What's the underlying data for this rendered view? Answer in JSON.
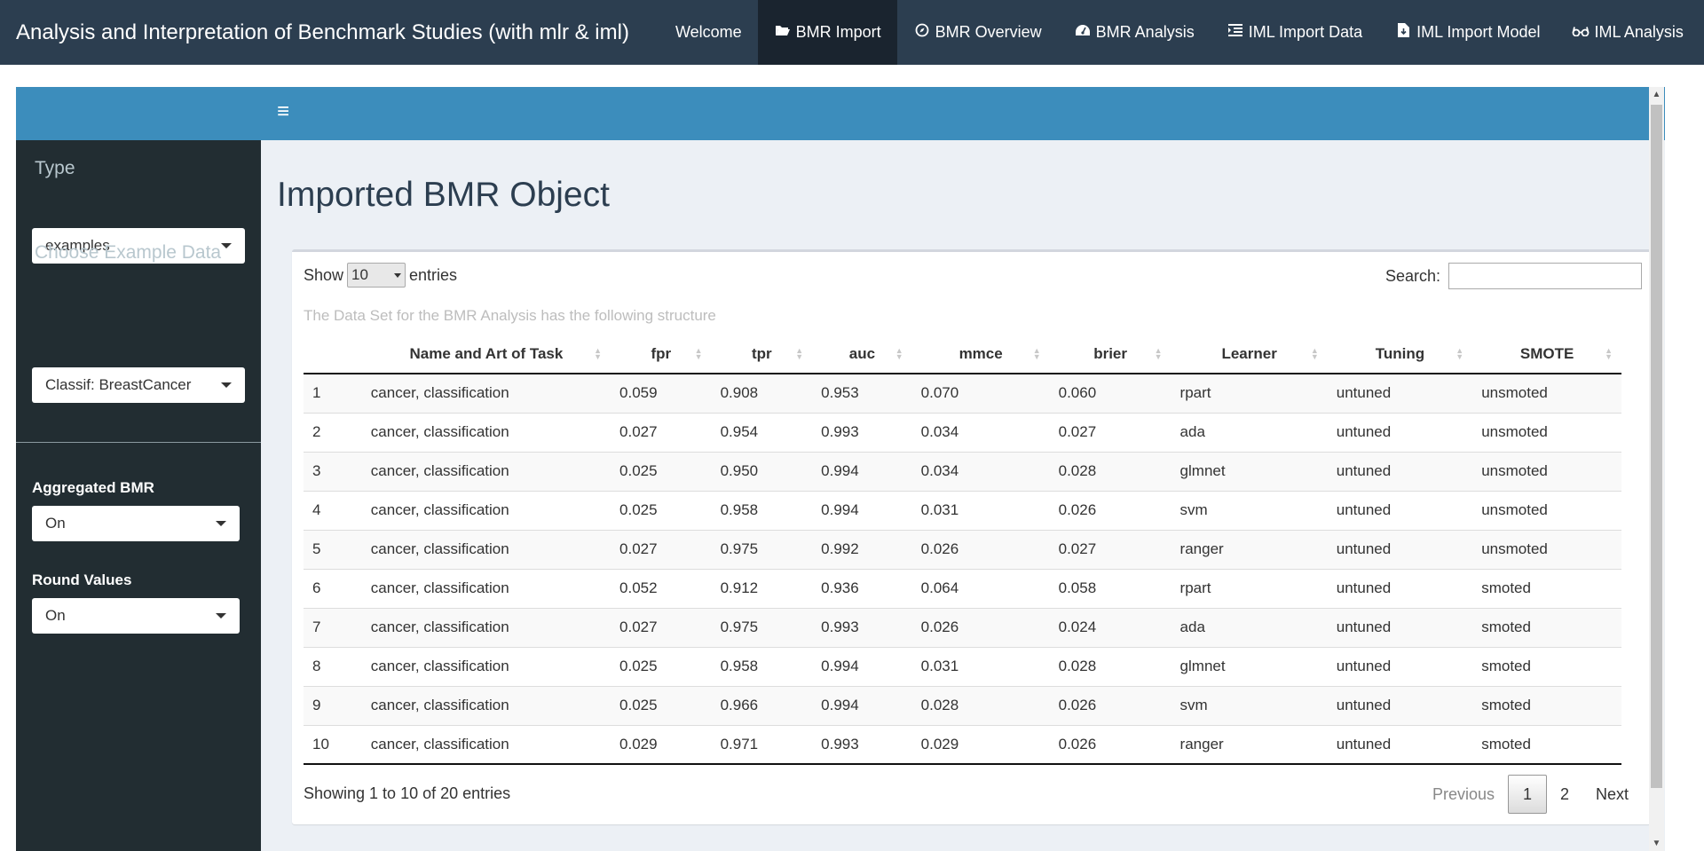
{
  "app": {
    "title": "Analysis and Interpretation of Benchmark Studies (with mlr & iml)"
  },
  "nav": [
    {
      "label": "Welcome",
      "icon": "",
      "active": false
    },
    {
      "label": "BMR Import",
      "icon": "folder-open-icon",
      "active": true
    },
    {
      "label": "BMR Overview",
      "icon": "compass-icon",
      "active": false
    },
    {
      "label": "BMR Analysis",
      "icon": "dashboard-icon",
      "active": false
    },
    {
      "label": "IML Import Data",
      "icon": "indent-icon",
      "active": false
    },
    {
      "label": "IML Import Model",
      "icon": "file-import-icon",
      "active": false
    },
    {
      "label": "IML Analysis",
      "icon": "glasses-icon",
      "active": false
    }
  ],
  "sidebar": {
    "type_label": "Type",
    "type_value": "examples",
    "example_label": "Choose Example Data",
    "example_value": "Classif: BreastCancer",
    "aggregated_label": "Aggregated BMR",
    "aggregated_value": "On",
    "round_label": "Round Values",
    "round_value": "On"
  },
  "main": {
    "title": "Imported BMR Object",
    "show_label": "Show",
    "length_value": "10",
    "entries_label": "entries",
    "search_label": "Search:",
    "search_value": "",
    "caption": "The Data Set for the BMR Analysis has the following structure",
    "info": "Showing 1 to 10 of 20 entries",
    "pager": {
      "previous": "Previous",
      "pages": [
        "1",
        "2"
      ],
      "current": "1",
      "next": "Next"
    }
  },
  "table": {
    "columns": [
      "",
      "Name and Art of Task",
      "fpr",
      "tpr",
      "auc",
      "mmce",
      "brier",
      "Learner",
      "Tuning",
      "SMOTE"
    ],
    "rows": [
      [
        "1",
        "cancer, classification",
        "0.059",
        "0.908",
        "0.953",
        "0.070",
        "0.060",
        "rpart",
        "untuned",
        "unsmoted"
      ],
      [
        "2",
        "cancer, classification",
        "0.027",
        "0.954",
        "0.993",
        "0.034",
        "0.027",
        "ada",
        "untuned",
        "unsmoted"
      ],
      [
        "3",
        "cancer, classification",
        "0.025",
        "0.950",
        "0.994",
        "0.034",
        "0.028",
        "glmnet",
        "untuned",
        "unsmoted"
      ],
      [
        "4",
        "cancer, classification",
        "0.025",
        "0.958",
        "0.994",
        "0.031",
        "0.026",
        "svm",
        "untuned",
        "unsmoted"
      ],
      [
        "5",
        "cancer, classification",
        "0.027",
        "0.975",
        "0.992",
        "0.026",
        "0.027",
        "ranger",
        "untuned",
        "unsmoted"
      ],
      [
        "6",
        "cancer, classification",
        "0.052",
        "0.912",
        "0.936",
        "0.064",
        "0.058",
        "rpart",
        "untuned",
        "smoted"
      ],
      [
        "7",
        "cancer, classification",
        "0.027",
        "0.975",
        "0.993",
        "0.026",
        "0.024",
        "ada",
        "untuned",
        "smoted"
      ],
      [
        "8",
        "cancer, classification",
        "0.025",
        "0.958",
        "0.994",
        "0.031",
        "0.028",
        "glmnet",
        "untuned",
        "smoted"
      ],
      [
        "9",
        "cancer, classification",
        "0.025",
        "0.966",
        "0.994",
        "0.028",
        "0.026",
        "svm",
        "untuned",
        "smoted"
      ],
      [
        "10",
        "cancer, classification",
        "0.029",
        "0.971",
        "0.993",
        "0.029",
        "0.026",
        "ranger",
        "untuned",
        "smoted"
      ]
    ]
  }
}
